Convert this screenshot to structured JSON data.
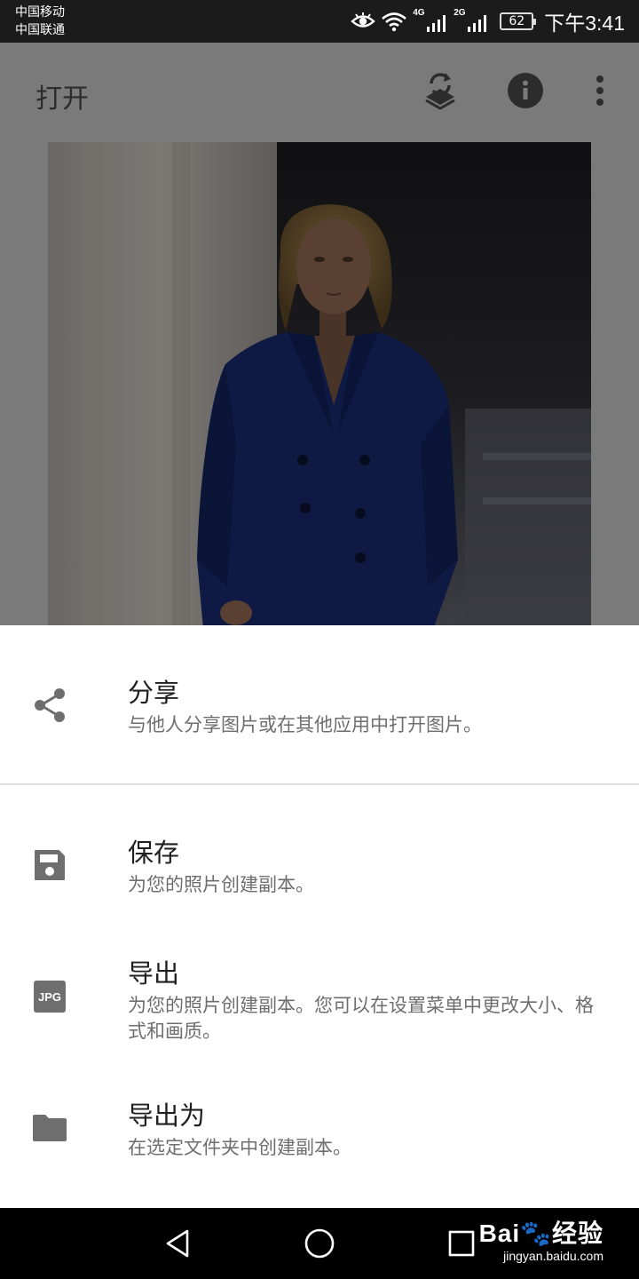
{
  "status_bar": {
    "carrier1": "中国移动",
    "carrier2": "中国联通",
    "net1": "4G",
    "net2": "2G",
    "battery": "62",
    "time": "下午3:41",
    "icons": [
      "eye-icon",
      "wifi-icon",
      "signal-icon",
      "signal-icon",
      "battery-icon"
    ]
  },
  "app_bar": {
    "title": "打开",
    "icons": [
      "layers-swap-icon",
      "info-icon",
      "more-vert-icon"
    ]
  },
  "sheet": {
    "items": [
      {
        "title": "分享",
        "desc": "与他人分享图片或在其他应用中打开图片。",
        "icon": "share-icon"
      },
      {
        "title": "保存",
        "desc": "为您的照片创建副本。",
        "icon": "save-icon"
      },
      {
        "title": "导出",
        "desc": "为您的照片创建副本。您可以在设置菜单中更改大小、格式和画质。",
        "icon": "jpg-icon",
        "icon_text": "JPG"
      },
      {
        "title": "导出为",
        "desc": "在选定文件夹中创建副本。",
        "icon": "folder-icon"
      }
    ]
  },
  "nav_bar": {
    "icons": [
      "back-icon",
      "home-icon",
      "recents-icon"
    ]
  },
  "watermark": {
    "logo": "Bai🐾经验",
    "url": "jingyan.baidu.com"
  },
  "colors": {
    "overlay": "#7a7a7a",
    "sheet_bg": "#ffffff",
    "icon_gray": "#6e6e6e",
    "jacket": "#0e1a44"
  }
}
